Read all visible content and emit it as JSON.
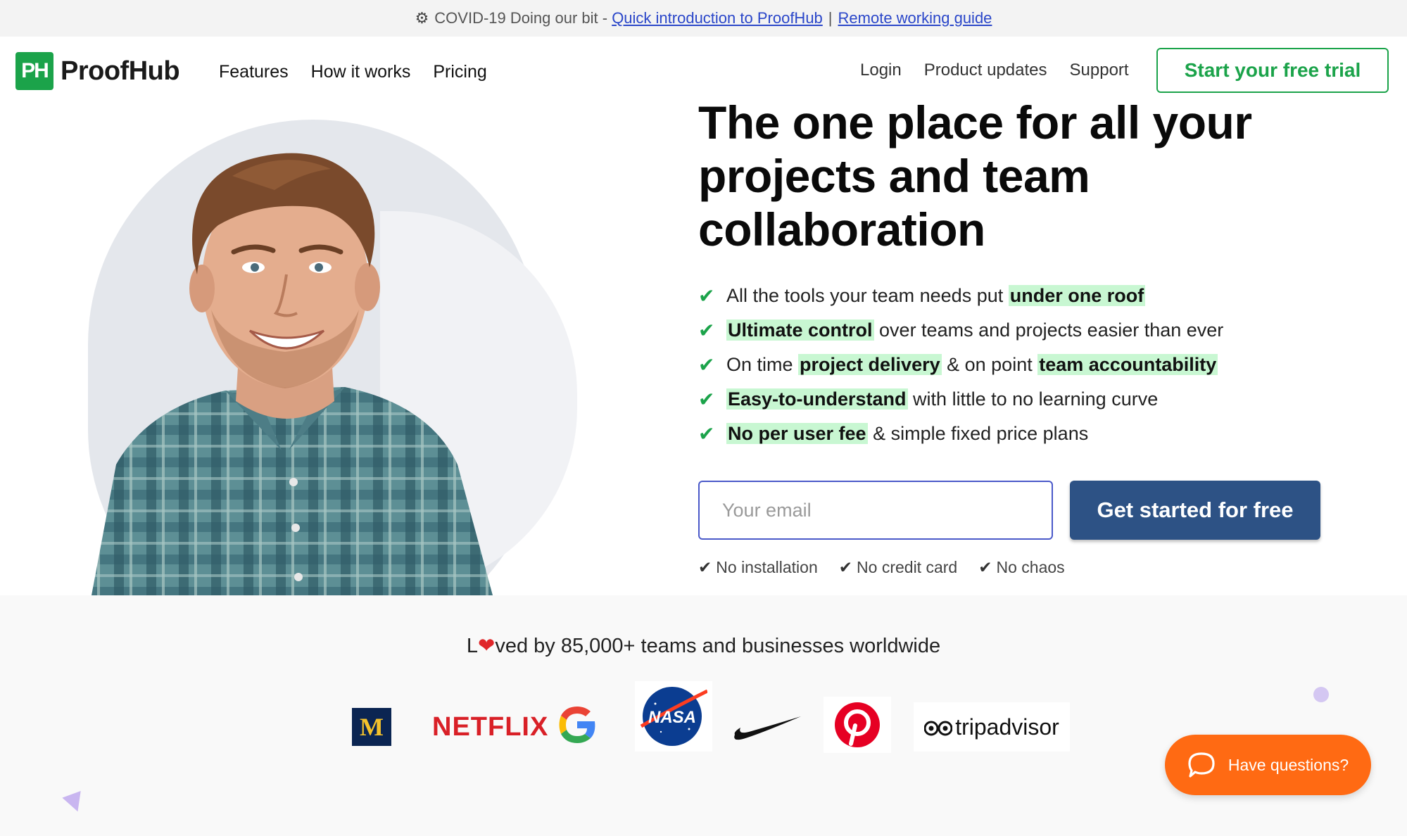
{
  "notice": {
    "icon": "gear-icon",
    "text": "COVID-19 Doing our bit -",
    "link1": "Quick introduction to ProofHub",
    "separator": "|",
    "link2": "Remote working guide"
  },
  "header": {
    "logo_mark": "PH",
    "logo_text": "ProofHub",
    "nav_left": [
      "Features",
      "How it works",
      "Pricing"
    ],
    "nav_right": [
      "Login",
      "Product updates",
      "Support"
    ],
    "trial_button": "Start your free trial"
  },
  "hero": {
    "headline": "The one place for all your projects and team collaboration",
    "bullets": [
      {
        "parts": [
          {
            "t": "All the tools your team needs put ",
            "hl": false
          },
          {
            "t": "under one roof",
            "hl": true
          }
        ]
      },
      {
        "parts": [
          {
            "t": "Ultimate control",
            "hl": true
          },
          {
            "t": " over teams and projects easier than ever",
            "hl": false
          }
        ]
      },
      {
        "parts": [
          {
            "t": "On time ",
            "hl": false
          },
          {
            "t": "project delivery",
            "hl": true
          },
          {
            "t": " & on point ",
            "hl": false
          },
          {
            "t": "team accountability",
            "hl": true
          }
        ]
      },
      {
        "parts": [
          {
            "t": "Easy-to-understand",
            "hl": true
          },
          {
            "t": " with little to no learning curve",
            "hl": false
          }
        ]
      },
      {
        "parts": [
          {
            "t": "No per user fee",
            "hl": true
          },
          {
            "t": " & simple fixed price plans",
            "hl": false
          }
        ]
      }
    ],
    "email_placeholder": "Your email",
    "cta": "Get started for free",
    "assurances": [
      "No installation",
      "No credit card",
      "No chaos"
    ]
  },
  "social_proof": {
    "loved_prefix": "L",
    "loved_suffix": "ved by 85,000+ teams and businesses worldwide",
    "logos": [
      "michigan-medicine-logo",
      "netflix-logo",
      "google-logo",
      "nasa-logo",
      "nike-logo",
      "pinterest-logo",
      "tripadvisor-logo"
    ],
    "netflix_text": "NETFLIX",
    "nasa_text": "NASA",
    "tripadvisor_text": "tripadvisor"
  },
  "chat": {
    "label": "Have questions?",
    "accent": "#ff6a13"
  },
  "colors": {
    "brand_green": "#1ba34a",
    "cta_blue": "#2d5285",
    "highlight": "#c8f7d2"
  }
}
